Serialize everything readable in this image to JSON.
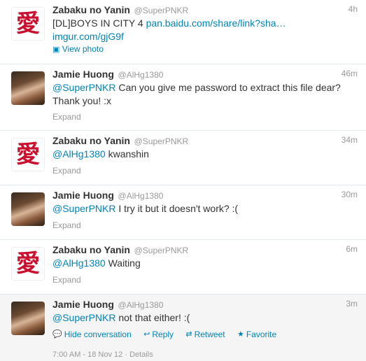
{
  "tweets": [
    {
      "avatar": "kanji-ai-avatar",
      "kanji": "愛",
      "name": "Zabaku no Yanin",
      "handle": "@SuperPNKR",
      "time": "4h",
      "text_prefix": "[DL]BOYS IN CITY 4 ",
      "link1": "pan.baidu.com/share/link?sha…",
      "link2": "imgur.com/gjG9f",
      "action": "View photo"
    },
    {
      "avatar": "photo-avatar",
      "name": "Jamie Huong",
      "handle": "@AlHg1380",
      "time": "46m",
      "mention": "@SuperPNKR",
      "text": " Can you give me password to extract this file dear? Thank you! :x",
      "expand": "Expand"
    },
    {
      "avatar": "kanji-ai-avatar",
      "kanji": "愛",
      "name": "Zabaku no Yanin",
      "handle": "@SuperPNKR",
      "time": "34m",
      "mention": "@AlHg1380",
      "text": " kwanshin",
      "expand": "Expand"
    },
    {
      "avatar": "photo-avatar",
      "name": "Jamie Huong",
      "handle": "@AlHg1380",
      "time": "30m",
      "mention": "@SuperPNKR",
      "text": " I try it but it doesn't work? :(",
      "expand": "Expand"
    },
    {
      "avatar": "kanji-ai-avatar",
      "kanji": "愛",
      "name": "Zabaku no Yanin",
      "handle": "@SuperPNKR",
      "time": "6m",
      "mention": "@AlHg1380",
      "text": " Waiting",
      "expand": "Expand"
    },
    {
      "avatar": "photo-avatar",
      "name": "Jamie Huong",
      "handle": "@AlHg1380",
      "time": "3m",
      "mention": "@SuperPNKR",
      "text": " not that either! :(",
      "actions": {
        "hide": "Hide conversation",
        "reply": "Reply",
        "retweet": "Retweet",
        "favorite": "Favorite"
      },
      "timestamp": "7:00 AM - 18 Nov 12",
      "details": "Details"
    }
  ],
  "colors": {
    "link": "#0084b4",
    "muted": "#999999",
    "kanji": "#c8102e"
  }
}
